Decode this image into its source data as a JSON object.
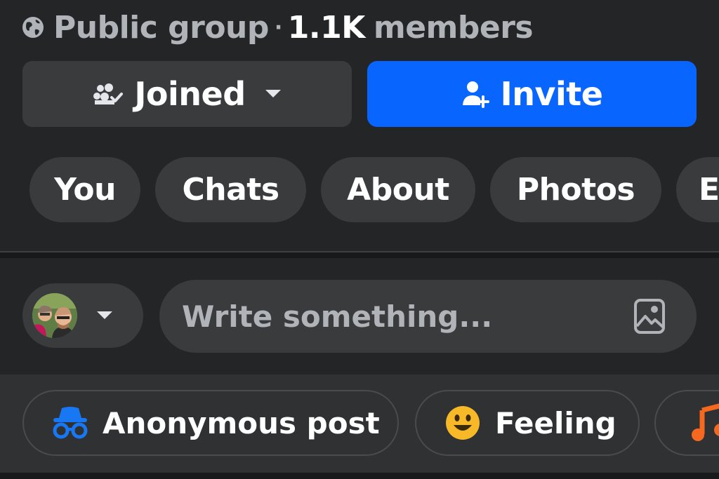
{
  "group": {
    "privacy": "Public group",
    "separator": "·",
    "member_count": "1.1K",
    "member_label": "members"
  },
  "actions": {
    "joined_label": "Joined",
    "invite_label": "Invite"
  },
  "tabs": [
    {
      "label": "You"
    },
    {
      "label": "Chats"
    },
    {
      "label": "About"
    },
    {
      "label": "Photos"
    },
    {
      "label": "E"
    }
  ],
  "composer": {
    "placeholder": "Write something..."
  },
  "post_options": [
    {
      "label": "Anonymous post",
      "icon": "anonymous-icon"
    },
    {
      "label": "Feeling",
      "icon": "smiley-icon"
    },
    {
      "label": "",
      "icon": "music-icon"
    }
  ],
  "colors": {
    "background": "#242526",
    "button": "#3a3b3c",
    "accent": "#0866ff",
    "muted_text": "#b0b3b8"
  }
}
